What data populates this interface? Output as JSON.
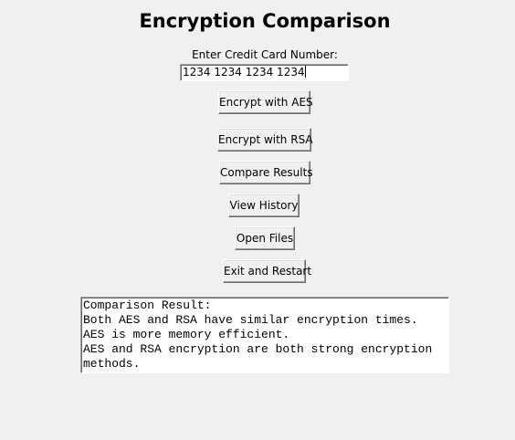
{
  "window": {
    "title": "Encryption Comparison"
  },
  "form": {
    "card_label": "Enter Credit Card Number:",
    "card_value": "1234 1234 1234 1234"
  },
  "buttons": {
    "encrypt_aes": "Encrypt with AES",
    "encrypt_rsa": "Encrypt with RSA",
    "compare": "Compare Results",
    "history": "View History",
    "open_files": "Open Files",
    "exit_restart": "Exit and Restart"
  },
  "result": {
    "lines": [
      "Comparison Result:",
      "Both AES and RSA have similar encryption times.",
      "AES is more memory efficient.",
      "AES and RSA encryption are both strong encryption",
      "methods."
    ]
  }
}
